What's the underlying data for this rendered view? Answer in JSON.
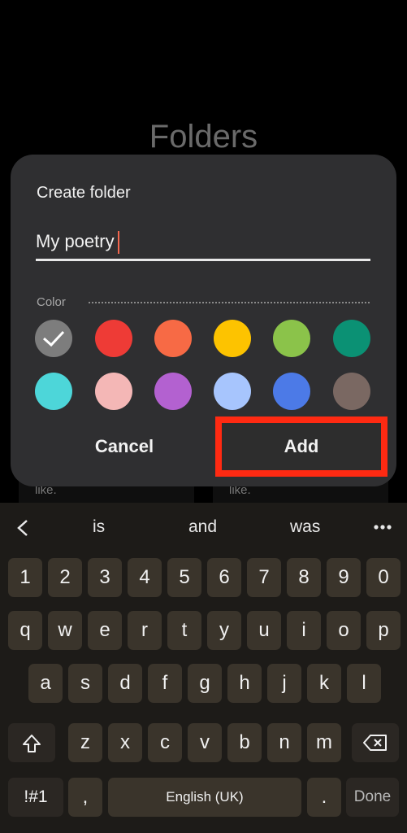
{
  "background": {
    "title": "Folders",
    "card_snippets": [
      "like.",
      "like."
    ]
  },
  "dialog": {
    "title": "Create folder",
    "input_value": "My poetry",
    "color_label": "Color",
    "colors": [
      "#7d7d7d",
      "#ee3b36",
      "#f76a45",
      "#fdc300",
      "#8bc34a",
      "#0b9174",
      "#4dd6d9",
      "#f4b7b6",
      "#b361d0",
      "#a7c5fd",
      "#4c7ae7",
      "#7a6862"
    ],
    "selected_color_index": 0,
    "cancel_label": "Cancel",
    "add_label": "Add"
  },
  "keyboard": {
    "suggestions": [
      "is",
      "and",
      "was"
    ],
    "row_numbers": [
      "1",
      "2",
      "3",
      "4",
      "5",
      "6",
      "7",
      "8",
      "9",
      "0"
    ],
    "row1": [
      "q",
      "w",
      "e",
      "r",
      "t",
      "y",
      "u",
      "i",
      "o",
      "p"
    ],
    "row2": [
      "a",
      "s",
      "d",
      "f",
      "g",
      "h",
      "j",
      "k",
      "l"
    ],
    "row3": [
      "z",
      "x",
      "c",
      "v",
      "b",
      "n",
      "m"
    ],
    "symbols_label": "!#1",
    "comma_label": ",",
    "space_label": "English (UK)",
    "period_label": ".",
    "done_label": "Done",
    "accent_color": "#ff2a12"
  }
}
